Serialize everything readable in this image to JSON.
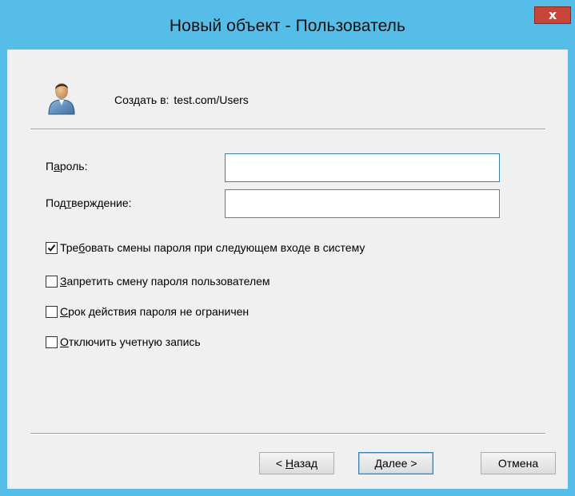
{
  "window": {
    "title": "Новый объект - Пользователь",
    "close_label": "x"
  },
  "header": {
    "create_in_label": "Создать в:",
    "create_in_path": "test.com/Users",
    "icon": "user-avatar-icon"
  },
  "fields": {
    "password_label_prefix": "П",
    "password_label_accel": "а",
    "password_label_rest": "роль:",
    "password_value": "",
    "confirm_label_prefix": "Под",
    "confirm_label_accel": "т",
    "confirm_label_rest": "верждение:",
    "confirm_value": ""
  },
  "checkboxes": [
    {
      "prefix": "Тре",
      "accel": "б",
      "rest": "овать смены пароля при следующем входе в систему",
      "checked": true
    },
    {
      "prefix": "",
      "accel": "З",
      "rest": "апретить смену пароля пользователем",
      "checked": false
    },
    {
      "prefix": "",
      "accel": "С",
      "rest": "рок действия пароля не ограничен",
      "checked": false
    },
    {
      "prefix": "",
      "accel": "О",
      "rest": "тключить учетную запись",
      "checked": false
    }
  ],
  "buttons": {
    "back_prefix": "< ",
    "back_accel": "Н",
    "back_rest": "азад",
    "next_accel": "Д",
    "next_rest": "алее >",
    "cancel": "Отмена"
  },
  "colors": {
    "titlebar": "#56bde8",
    "close": "#c7463a",
    "client": "#f0f0f0"
  }
}
